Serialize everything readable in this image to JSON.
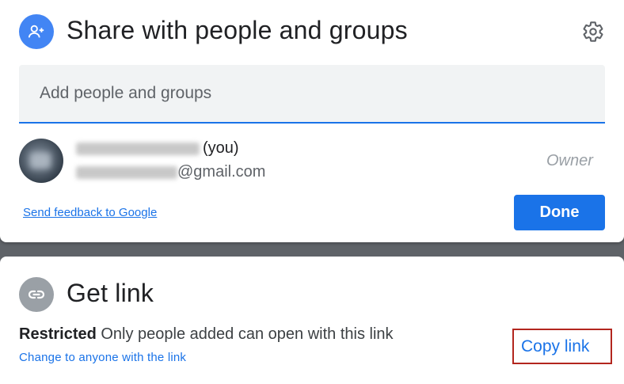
{
  "share_dialog": {
    "title": "Share with people and groups",
    "icon": "person-add-icon",
    "settings_icon": "gear-icon",
    "add_input": {
      "placeholder": "Add people and groups",
      "value": ""
    },
    "user": {
      "name_suffix": "(you)",
      "email_suffix": "@gmail.com",
      "role": "Owner"
    },
    "feedback_link": "Send feedback to Google",
    "done_button": "Done"
  },
  "link_dialog": {
    "title": "Get link",
    "icon": "link-icon",
    "restricted_label": "Restricted",
    "restricted_description": "Only people added can open with this link",
    "change_link": "Change to anyone with the link",
    "copy_link_button": "Copy link"
  },
  "colors": {
    "accent": "#1a73e8",
    "share_icon_bg": "#4285f4",
    "link_icon_bg": "#9aa0a6",
    "highlight_border": "#b3261e",
    "backdrop": "#5f6368"
  }
}
